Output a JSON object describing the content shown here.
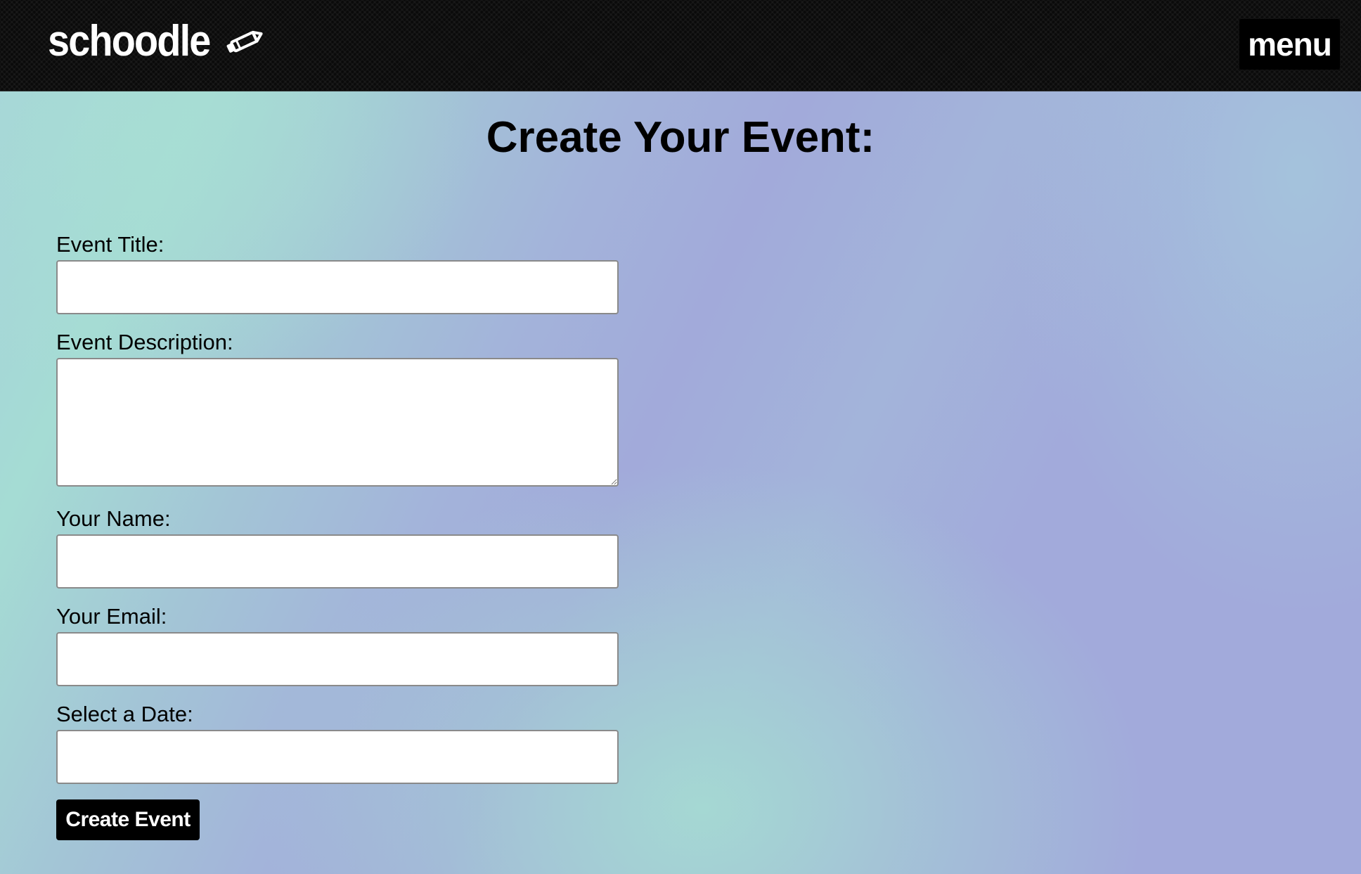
{
  "header": {
    "brand_name": "schoodle",
    "brand_icon": "pencil-icon",
    "menu_label": "menu"
  },
  "page": {
    "title": "Create Your Event:"
  },
  "form": {
    "event_title_label": "Event Title:",
    "event_title_value": "",
    "event_description_label": "Event Description:",
    "event_description_value": "",
    "your_name_label": "Your Name:",
    "your_name_value": "",
    "your_email_label": "Your Email:",
    "your_email_value": "",
    "date_label": "Select a Date:",
    "date_value": "",
    "submit_label": "Create Event"
  },
  "colors": {
    "header_bg": "#0a0a0a",
    "button_bg": "#000000",
    "gradient_teal": "#a5dcd4",
    "gradient_lavender": "#a2aada"
  }
}
